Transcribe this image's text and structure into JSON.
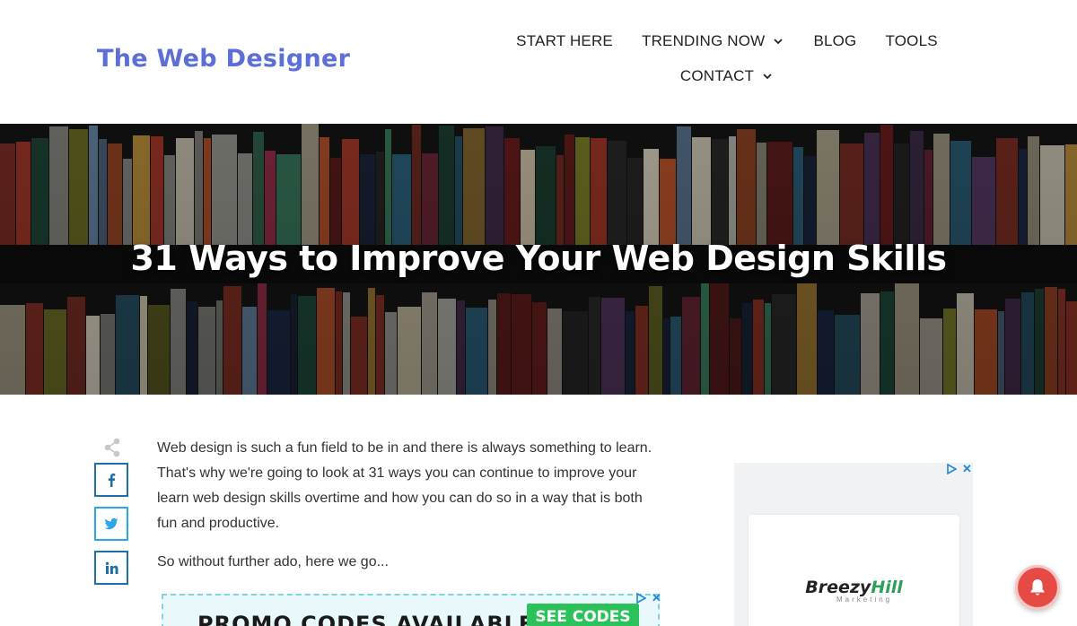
{
  "site": {
    "logo": "The Web Designer"
  },
  "nav": {
    "row1": [
      {
        "label": "START HERE",
        "dropdown": false
      },
      {
        "label": "TRENDING NOW",
        "dropdown": true
      },
      {
        "label": "BLOG",
        "dropdown": false
      },
      {
        "label": "TOOLS",
        "dropdown": false
      }
    ],
    "row2": [
      {
        "label": "CONTACT",
        "dropdown": true
      }
    ]
  },
  "hero": {
    "title": "31 Ways to Improve Your Web Design Skills"
  },
  "share": {
    "buttons": [
      "facebook-icon",
      "twitter-icon",
      "linkedin-icon"
    ]
  },
  "article": {
    "paragraphs": [
      "Web design is such a fun field to be in and there is always something to learn. That's why we're going to look at 31 ways you can continue to improve your learn web design skills overtime and how you can do so in a way that is both fun and productive.",
      "So without further ado, here we go..."
    ]
  },
  "promo_ad": {
    "text": "PROMO CODES AVAILABLE",
    "button": "SEE CODES",
    "close": "✕"
  },
  "side_ad": {
    "brand_part1": "Breezy",
    "brand_part2": "Hill",
    "brand_tagline": "Marketing",
    "close": "✕"
  },
  "colors": {
    "logo": "#5b6fd6",
    "facebook": "#1d6fa5",
    "twitter": "#2ca8e8",
    "bell": "#e64a45",
    "promo_button": "#2bc25a"
  }
}
